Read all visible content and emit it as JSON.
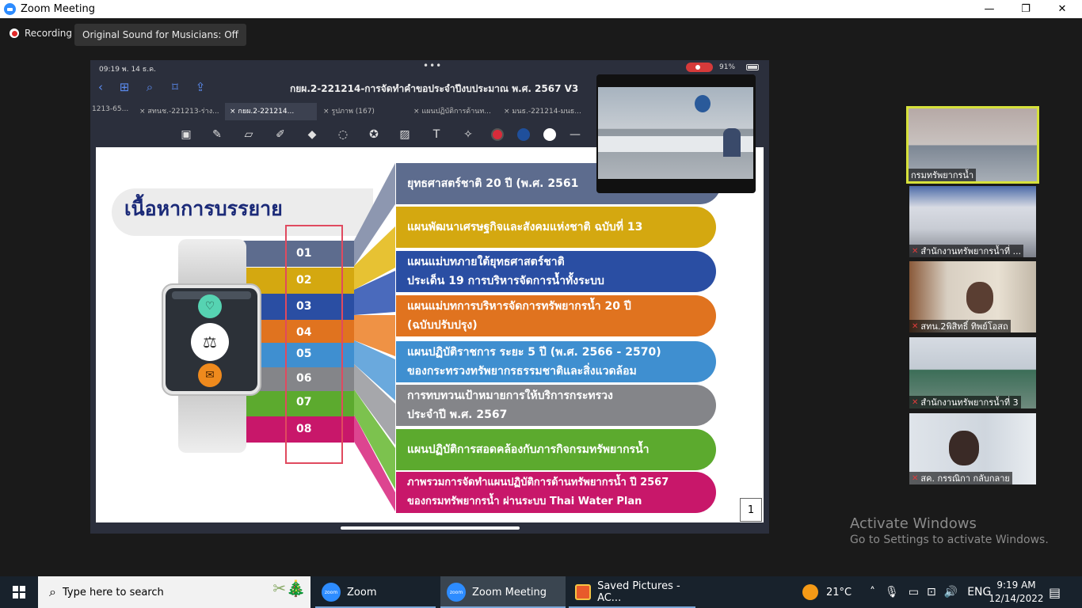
{
  "window": {
    "title": "Zoom Meeting",
    "minimize": "—",
    "maximize": "❐",
    "close": "✕"
  },
  "meeting_bar": {
    "recording_label": "Recording",
    "original_sound": "Original Sound for Musicians: Off"
  },
  "shared_screen": {
    "status_time": "09:19  พ. 14 ธ.ค.",
    "status_dots": "•••",
    "battery": "91%",
    "doc_title": "กยผ.2-221214-การจัดทำคำขอประจำปีงบประมาณ พ.ศ. 2567 V3",
    "tabs": [
      {
        "label": "1213-65..."
      },
      {
        "label": "สทนช.-221213-ร่าง..."
      },
      {
        "label": "กยผ.2-221214..."
      },
      {
        "label": "รูปภาพ (167)"
      },
      {
        "label": "แผนปฏิบัติการด้านท..."
      },
      {
        "label": "มนธ.-221214-มนธ..."
      }
    ],
    "slide": {
      "title": "เนื้อหาการบรรยาย",
      "items": [
        {
          "num": "01",
          "text": "ยุทธศาสตร์ชาติ 20 ปี (พ.ศ. 2561",
          "color": "#5d6c8e"
        },
        {
          "num": "02",
          "text": "แผนพัฒนาเศรษฐกิจและสังคมแห่งชาติ ฉบับที่ 13",
          "color": "#d4a810"
        },
        {
          "num": "03",
          "text": "แผนแม่บทภายใต้ยุทธศาสตร์ชาติ\nประเด็น 19 การบริหารจัดการน้ำทั้งระบบ",
          "color": "#2a4ea3"
        },
        {
          "num": "04",
          "text": "แผนแม่บทการบริหารจัดการทรัพยากรน้ำ 20 ปี\n(ฉบับปรับปรุง)",
          "color": "#e0731f"
        },
        {
          "num": "05",
          "text": "แผนปฏิบัติราชการ ระยะ 5 ปี (พ.ศ. 2566 - 2570)\nของกระทรวงทรัพยากรธรรมชาติและสิ่งแวดล้อม",
          "color": "#3f8fd0"
        },
        {
          "num": "06",
          "text": "การทบทวนเป้าหมายการให้บริการกระทรวง\nประจำปี พ.ศ. 2567",
          "color": "#848589"
        },
        {
          "num": "07",
          "text": "แผนปฏิบัติการสอดคล้องกับภารกิจกรมทรัพยากรน้ำ",
          "color": "#5caa2e"
        },
        {
          "num": "08",
          "text": "ภาพรวมการจัดทำแผนปฏิบัติการด้านทรัพยากรน้ำ ปี 2567\nของกรมทรัพยากรน้ำ ผ่านระบบ Thai Water Plan",
          "color": "#c8176a"
        }
      ],
      "page_number": "1"
    }
  },
  "gallery": [
    {
      "name": "กรมทรัพยากรน้ำ",
      "muted": false,
      "active": true
    },
    {
      "name": "สำนักงานทรัพยากรน้ำที่ ...",
      "muted": true,
      "active": false
    },
    {
      "name": "สทน.2พิสิทธิ์ ทิพย์โอสถ",
      "muted": true,
      "active": false
    },
    {
      "name": "สำนักงานทรัพยากรน้ำที่ 3",
      "muted": true,
      "active": false
    },
    {
      "name": "สค. กรรณิกา กลับกลาย",
      "muted": true,
      "active": false
    }
  ],
  "watermark": {
    "line1": "Activate Windows",
    "line2": "Go to Settings to activate Windows."
  },
  "taskbar": {
    "search_placeholder": "Type here to search",
    "apps": [
      {
        "label": "Zoom"
      },
      {
        "label": "Zoom Meeting"
      },
      {
        "label": "Saved Pictures - AC..."
      }
    ],
    "temperature": "21°C",
    "language": "ENG",
    "time": "9:19 AM",
    "date": "12/14/2022"
  },
  "colors": {
    "zoom_blue": "#2D8CFF",
    "active_speaker": "#d6e13b",
    "slide_title": "#1b2a78",
    "number_box": "#e04a5f"
  }
}
